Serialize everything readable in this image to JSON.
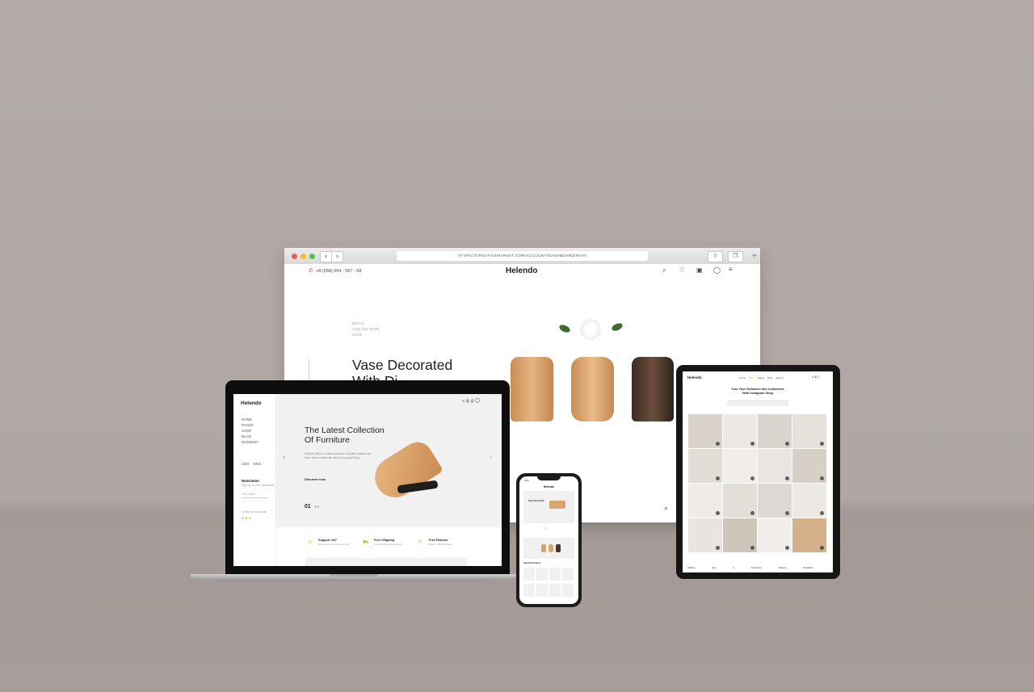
{
  "browser": {
    "url": "HTTPS://CREATIVEMARKET.COM/ACCOUNT/DASHBOARD/MAIN",
    "phone": "+8 (268) 654 - 567 - 68",
    "logo": "Helendo",
    "eyebrow": [
      "DECO",
      "COLLECTION",
      "2019"
    ],
    "headline_line1": "Vase Decorated",
    "headline_line2": "With Di"
  },
  "laptop": {
    "logo": "Helendo",
    "menu": [
      "HOME",
      "PAGES",
      "SHOP",
      "BLOG",
      "ELEMENT"
    ],
    "currency": "USD",
    "language": "ENG",
    "newsletter_title": "Newsletter",
    "newsletter_text": "Sign up for our newsletter",
    "email_placeholder": "Your email",
    "follow": "Follow us on social",
    "hero_line1": "The Latest Collection",
    "hero_line2": "Of Furniture",
    "hero_desc": "Helendo offers a curated collection of modern furniture and home decor crafted with care for everyday living.",
    "cta": "Discover now",
    "slide_current": "01",
    "slide_total": "/03",
    "features": [
      {
        "title": "Support 24/7",
        "text": "We are here to help you 24/7"
      },
      {
        "title": "Free Shipping",
        "text": "Free shipping on all orders"
      },
      {
        "title": "Free Returns",
        "text": "Return within 30 days"
      }
    ]
  },
  "tablet": {
    "logo": "Helendo",
    "nav": [
      "Home",
      "Shop",
      "Pages",
      "Blog",
      "Search"
    ],
    "title_line1": "Turn Your Followers Into Customers",
    "title_line2": "With Instagram Shop",
    "footer": [
      "Address",
      "Help & Information",
      "Shipping",
      "Newsletter"
    ]
  },
  "phone": {
    "time": "9:41",
    "logo": "Helendo",
    "card_title": "Vase Decorated",
    "section": "Special Products"
  },
  "colors": {
    "background": "#b0a7a4",
    "accent": "#e4b339",
    "wood": "#d9a56f",
    "dark": "#1a1a1a"
  }
}
